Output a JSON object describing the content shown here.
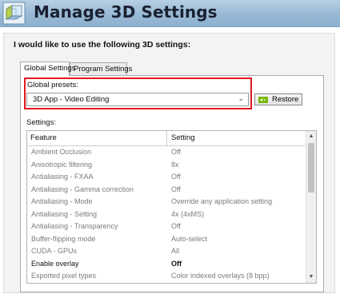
{
  "header": {
    "title": "Manage 3D Settings",
    "icon": "nvidia-3d-cube-icon"
  },
  "prompt": "I would like to use the following 3D settings:",
  "tabs": [
    {
      "label": "Global Settings",
      "active": true
    },
    {
      "label": "Program Settings",
      "active": false
    }
  ],
  "global_presets": {
    "label": "Global presets:",
    "selected": "3D App - Video Editing",
    "restore_label": "Restore",
    "highlight_color": "#e4161e"
  },
  "settings": {
    "label": "Settings:",
    "columns": [
      "Feature",
      "Setting"
    ],
    "rows": [
      {
        "feature": "Ambient Occlusion",
        "setting": "Off"
      },
      {
        "feature": "Anisotropic filtering",
        "setting": "8x"
      },
      {
        "feature": "Antialiasing - FXAA",
        "setting": "Off"
      },
      {
        "feature": "Antialiasing - Gamma correction",
        "setting": "Off"
      },
      {
        "feature": "Antialiasing - Mode",
        "setting": "Override any application setting"
      },
      {
        "feature": "Antialiasing - Setting",
        "setting": "4x (4xMS)"
      },
      {
        "feature": "Antialiasing - Transparency",
        "setting": "Off"
      },
      {
        "feature": "Buffer-flipping mode",
        "setting": "Auto-select"
      },
      {
        "feature": "CUDA - GPUs",
        "setting": "All"
      },
      {
        "feature": "Enable overlay",
        "setting": "Off"
      },
      {
        "feature": "Exported pixel types",
        "setting": "Color indexed overlays (8 bpp)"
      }
    ]
  }
}
